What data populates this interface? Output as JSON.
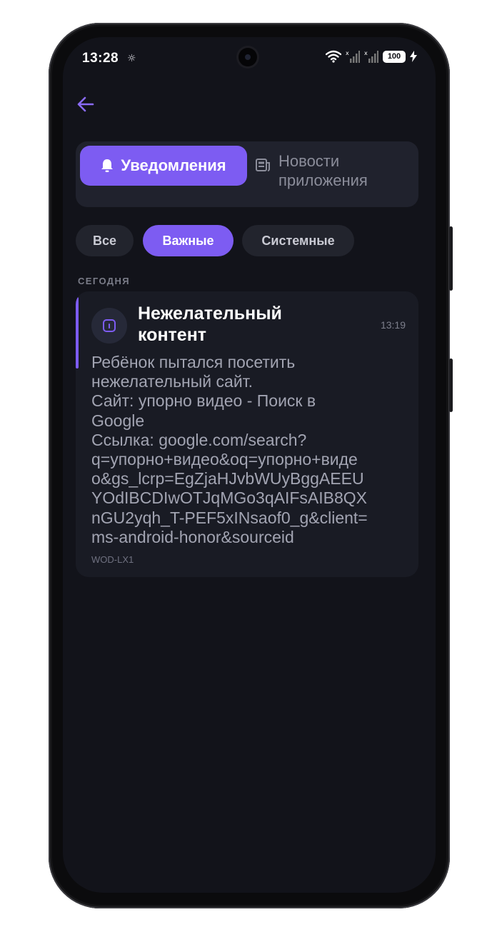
{
  "status_bar": {
    "time": "13:28",
    "battery": "100"
  },
  "tabs": {
    "notifications": "Уведомления",
    "app_news": "Новости приложения"
  },
  "filters": [
    {
      "label": "Все",
      "selected": false
    },
    {
      "label": "Важные",
      "selected": true
    },
    {
      "label": "Системные",
      "selected": false
    }
  ],
  "section_header": "СЕГОДНЯ",
  "notification": {
    "title": "Нежелательный контент",
    "time": "13:19",
    "body_lines": [
      "Ребёнок пытался посетить",
      "нежелательный сайт.",
      "Сайт: упорно видео - Поиск в",
      "Google",
      "Ссылка: google.com/search?",
      "q=упорно+видео&oq=упорно+виде",
      "o&gs_lcrp=EgZjaHJvbWUyBggAEEU",
      "YOdIBCDIwOTJqMGo3qAIFsAIB8QX",
      "nGU2yqh_T-PEF5xINsaof0_g&client=",
      "ms-android-honor&sourceid"
    ],
    "device": "WOD-LX1"
  },
  "colors": {
    "accent": "#7d5cf2",
    "background": "#12131a",
    "card": "#191b24"
  }
}
